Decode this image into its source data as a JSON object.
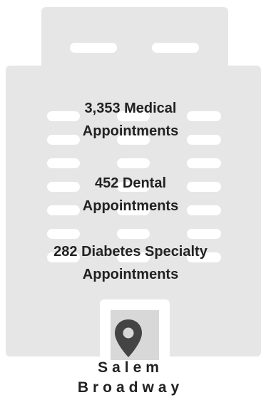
{
  "stats": {
    "medical": {
      "line1": "3,353 Medical",
      "line2": "Appointments"
    },
    "dental": {
      "line1": "452 Dental",
      "line2": "Appointments"
    },
    "diabetes": {
      "line1": "282 Diabetes Specialty",
      "line2": "Appointments"
    }
  },
  "location": {
    "line1": "Salem",
    "line2": "Broadway"
  },
  "icons": {
    "pin": "map-pin-icon",
    "building": "building-icon"
  },
  "colors": {
    "building": "#e6e6e6",
    "window": "#ffffff",
    "door_inner": "#d8d8d8",
    "text": "#222222",
    "pin": "#444444"
  }
}
